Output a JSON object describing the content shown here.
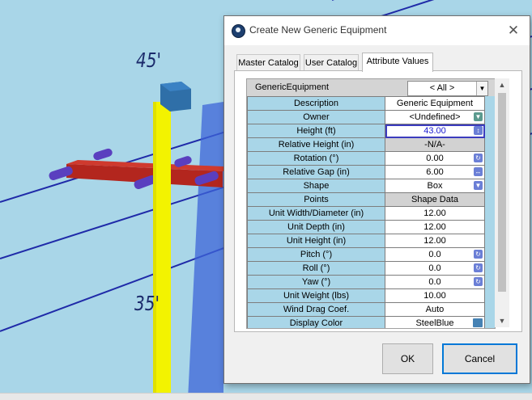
{
  "viewport": {
    "labels": {
      "top_pole_label": "45'",
      "bottom_pole_label": "35'"
    }
  },
  "dialog": {
    "title": "Create New Generic Equipment",
    "close_icon": "close-icon",
    "tabs": [
      {
        "label": "Master Catalog",
        "active": false
      },
      {
        "label": "User Catalog",
        "active": false
      },
      {
        "label": "Attribute Values",
        "active": true
      }
    ],
    "grid": {
      "header_label": "GenericEquipment",
      "category_value": "< All >",
      "rows": [
        {
          "name": "Description",
          "value": "Generic Equipment",
          "style": "normal",
          "button": ""
        },
        {
          "name": "Owner",
          "value": "<Undefined>",
          "style": "normal",
          "button": "dropdown-icon"
        },
        {
          "name": "Height (ft)",
          "value": "43.00",
          "style": "selected",
          "button": "spinner-icon"
        },
        {
          "name": "Relative Height (in)",
          "value": "-N/A-",
          "style": "gray",
          "button": ""
        },
        {
          "name": "Rotation (°)",
          "value": "0.00",
          "style": "normal",
          "button": "rotate-icon"
        },
        {
          "name": "Relative Gap (in)",
          "value": "6.00",
          "style": "normal",
          "button": "gap-arrows-icon"
        },
        {
          "name": "Shape",
          "value": "Box",
          "style": "normal",
          "button": "dropdown-icon"
        },
        {
          "name": "Points",
          "value": "Shape Data",
          "style": "gray",
          "button": ""
        },
        {
          "name": "Unit Width/Diameter (in)",
          "value": "12.00",
          "style": "normal",
          "button": ""
        },
        {
          "name": "Unit Depth (in)",
          "value": "12.00",
          "style": "normal",
          "button": ""
        },
        {
          "name": "Unit Height (in)",
          "value": "12.00",
          "style": "normal",
          "button": ""
        },
        {
          "name": "Pitch (°)",
          "value": "0.0",
          "style": "normal",
          "button": "rotate-icon"
        },
        {
          "name": "Roll (°)",
          "value": "0.0",
          "style": "normal",
          "button": "rotate-icon"
        },
        {
          "name": "Yaw (°)",
          "value": "0.0",
          "style": "normal",
          "button": "rotate-icon"
        },
        {
          "name": "Unit Weight (lbs)",
          "value": "10.00",
          "style": "normal",
          "button": ""
        },
        {
          "name": "Wind Drag Coef.",
          "value": "Auto",
          "style": "normal",
          "button": ""
        },
        {
          "name": "Display Color",
          "value": "SteelBlue",
          "style": "normal",
          "button": "color-swatch"
        }
      ]
    },
    "buttons": {
      "ok": "OK",
      "cancel": "Cancel"
    }
  },
  "colors": {
    "viewport_background": "#a9d6e8",
    "pole": "#f3f300",
    "crossarm": "#b22222",
    "equipment_box": "#2f6fa8",
    "conductor": "#1f2aa8",
    "display_color_swatch": "#4682b4"
  }
}
